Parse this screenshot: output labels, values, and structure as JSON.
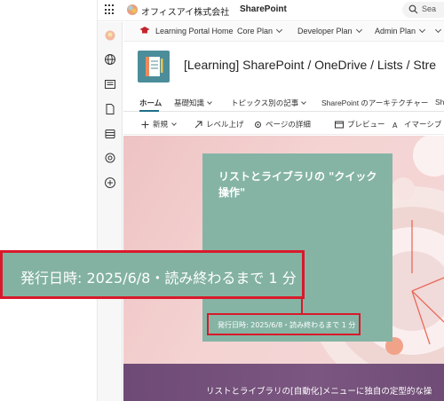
{
  "suite_bar": {
    "org_name": "オフィスアイ株式会社",
    "app_name": "SharePoint",
    "search_placeholder": "Sea"
  },
  "hub_nav": {
    "home": "Learning Portal Home",
    "items": [
      "Core Plan",
      "Developer Plan",
      "Admin Plan"
    ]
  },
  "site": {
    "title": "[Learning] SharePoint / OneDrive / Lists / Stre"
  },
  "site_nav": {
    "items": [
      "ホーム",
      "基礎知識",
      "トピックス別の記事",
      "SharePoint のアーキテクチャー",
      "Sh"
    ]
  },
  "command_bar": {
    "new": "新規",
    "level_up": "レベル上げ",
    "page_details": "ページの詳細",
    "preview": "プレビュー",
    "immersive": "イマーシブ リー"
  },
  "article": {
    "title": "リストとライブラリの \"クイック操作\"",
    "published": "発行日時: 2025/6/8・読み終わるまで 1 分",
    "body_line": "リストとライブラリの[自動化]メニューに独自の定型的な操"
  },
  "callout": {
    "text": "発行日時: 2025/6/8・読み終わるまで 1 分"
  },
  "colors": {
    "highlight_red": "#d9192b",
    "panel_green": "#85b4a5",
    "hero_pink": "#f4d3d2",
    "lower_purple": "#6e4b76"
  }
}
